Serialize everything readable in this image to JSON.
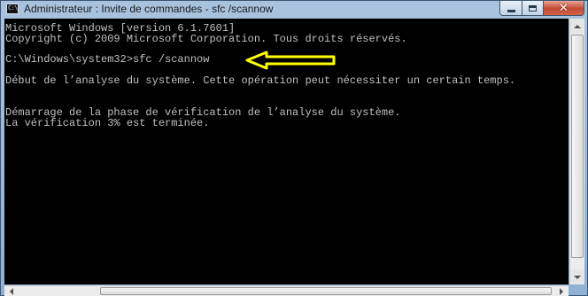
{
  "window": {
    "title": "Administrateur : Invite de commandes - sfc  /scannow",
    "icon": "cmd-icon",
    "icon_glyph": "C:\\"
  },
  "controls": {
    "minimize_icon": "minimize-icon",
    "maximize_icon": "maximize-icon",
    "close_icon": "close-icon",
    "close_glyph": "✕"
  },
  "console": {
    "background": "#000000",
    "text_color": "#c0c0c0",
    "lines": [
      "Microsoft Windows [version 6.1.7601]",
      "Copyright (c) 2009 Microsoft Corporation. Tous droits réservés.",
      "",
      "C:\\Windows\\system32>sfc /scannow",
      "Début de l’analyse du système. Cette opération peut nécessiter un certain temps.",
      "",
      "Démarrage de la phase de vérification de l’analyse du système.",
      "La vérification 3% est terminée."
    ]
  },
  "annotation": {
    "shape": "arrow-left",
    "color": "#ffff00"
  },
  "scrollbars": {
    "vertical": {
      "position": 0
    },
    "horizontal": {
      "position": 0
    }
  }
}
